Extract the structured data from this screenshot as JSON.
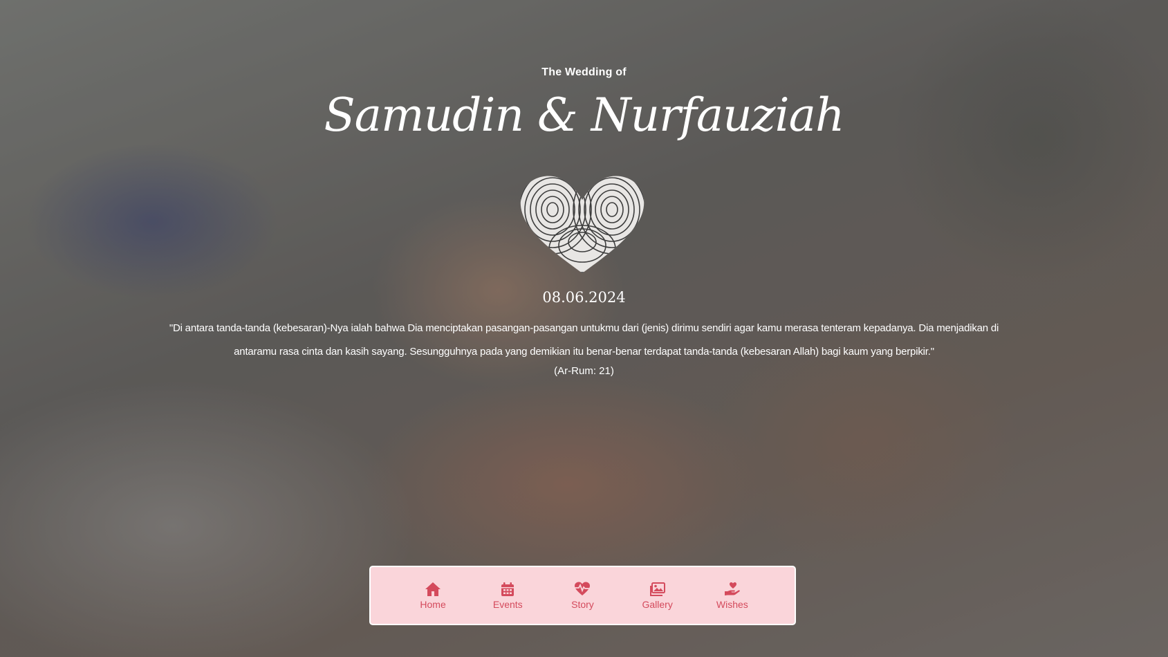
{
  "header": {
    "pre_title": "The Wedding of",
    "couple_names": "Samudin & Nurfauziah",
    "date": "08.06.2024"
  },
  "verse": {
    "text": "\"Di antara tanda-tanda (kebesaran)-Nya ialah bahwa Dia menciptakan pasangan-pasangan untukmu dari (jenis) dirimu sendiri agar kamu merasa tenteram kepadanya. Dia menjadikan di antaramu rasa cinta dan kasih sayang. Sesungguhnya pada yang demikian itu benar-benar terdapat tanda-tanda (kebesaran Allah) bagi kaum yang berpikir.\"",
    "source": "(Ar-Rum: 21)"
  },
  "nav": {
    "items": [
      {
        "label": "Home",
        "icon": "home-icon"
      },
      {
        "label": "Events",
        "icon": "calendar-icon"
      },
      {
        "label": "Story",
        "icon": "heart-pulse-icon"
      },
      {
        "label": "Gallery",
        "icon": "image-icon"
      },
      {
        "label": "Wishes",
        "icon": "hand-heart-icon"
      }
    ]
  },
  "colors": {
    "nav_background": "#fad5da",
    "nav_accent": "#d44a5c",
    "text": "#ffffff"
  }
}
